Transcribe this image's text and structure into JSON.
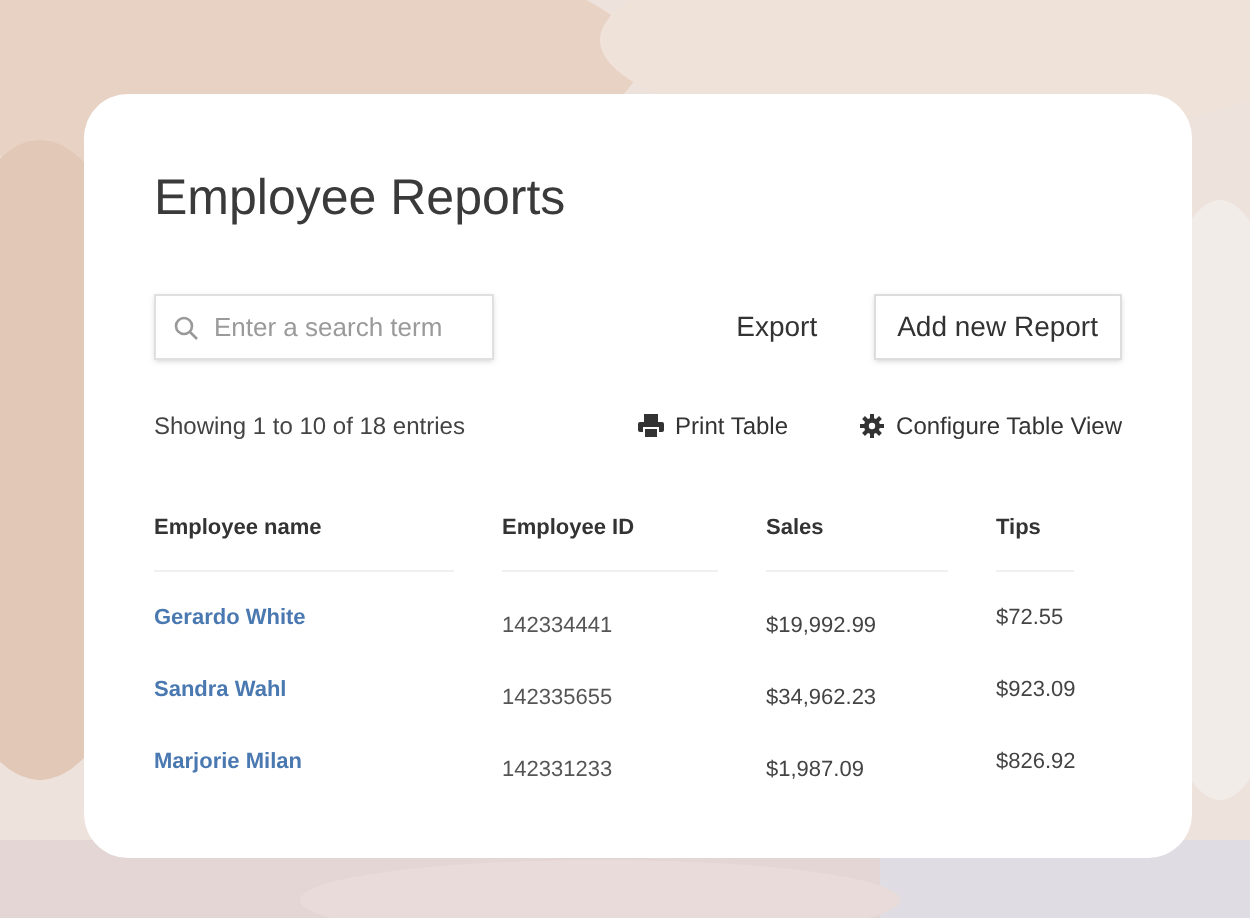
{
  "title": "Employee Reports",
  "search": {
    "placeholder": "Enter a search term"
  },
  "actions": [
    "Export",
    "Add new Report"
  ],
  "summary": "Showing 1 to 10 of 18 entries",
  "tools": [
    {
      "kind": "print",
      "label": "Print Table"
    },
    {
      "kind": "configure",
      "label": "Configure Table View"
    }
  ],
  "table": {
    "columns": [
      "Employee name",
      "Employee ID",
      "Sales",
      "Tips"
    ],
    "rows": [
      {
        "name": "Gerardo White",
        "id": "142334441",
        "sales": "$19,992.99",
        "tips": "$72.55"
      },
      {
        "name": "Sandra Wahl",
        "id": "142335655",
        "sales": "$34,962.23",
        "tips": "$923.09"
      },
      {
        "name": "Marjorie Milan",
        "id": "142331233",
        "sales": "$1,987.09",
        "tips": "$826.92"
      }
    ]
  }
}
